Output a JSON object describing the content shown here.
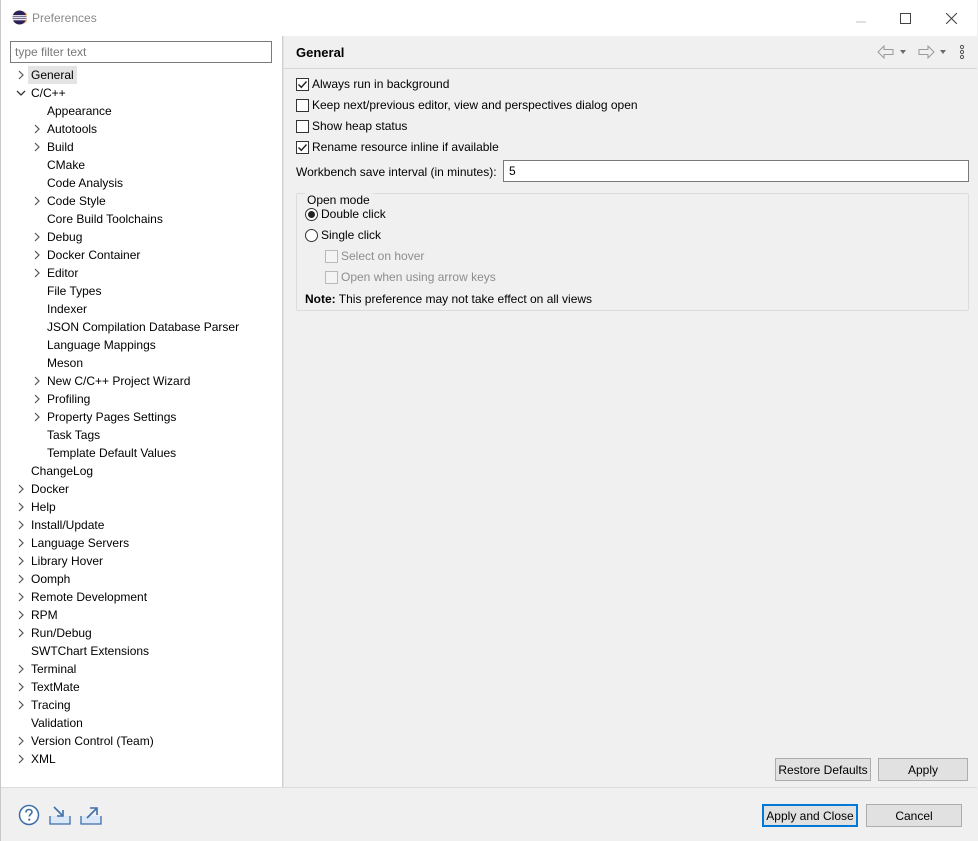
{
  "window": {
    "title": "Preferences"
  },
  "filter": {
    "placeholder": "type filter text"
  },
  "tree": {
    "general": "General",
    "cpp": "C/C++",
    "cpp_children": [
      "Appearance",
      "Autotools",
      "Build",
      "CMake",
      "Code Analysis",
      "Code Style",
      "Core Build Toolchains",
      "Debug",
      "Docker Container",
      "Editor",
      "File Types",
      "Indexer",
      "JSON Compilation Database Parser",
      "Language Mappings",
      "Meson",
      "New C/C++ Project Wizard",
      "Profiling",
      "Property Pages Settings",
      "Task Tags",
      "Template Default Values"
    ],
    "top_level": [
      "ChangeLog",
      "Docker",
      "Help",
      "Install/Update",
      "Language Servers",
      "Library Hover",
      "Oomph",
      "Remote Development",
      "RPM",
      "Run/Debug",
      "SWTChart Extensions",
      "Terminal",
      "TextMate",
      "Tracing",
      "Validation",
      "Version Control (Team)",
      "XML"
    ]
  },
  "page": {
    "title": "General",
    "always_run": "Always run in background",
    "keep_dialog": "Keep next/previous editor, view and perspectives dialog open",
    "heap_status": "Show heap status",
    "rename_inline": "Rename resource inline if available",
    "save_interval_label": "Workbench save interval (in minutes):",
    "save_interval_value": "5",
    "open_mode": {
      "legend": "Open mode",
      "double_click": "Double click",
      "single_click": "Single click",
      "select_on_hover": "Select on hover",
      "open_arrow_keys": "Open when using arrow keys",
      "note_label": "Note:",
      "note_text": "This preference may not take effect on all views"
    }
  },
  "buttons": {
    "restore_defaults": "Restore Defaults",
    "apply": "Apply",
    "apply_and_close": "Apply and Close",
    "cancel": "Cancel"
  },
  "icons": {
    "app": "eclipse-icon",
    "help": "help-icon",
    "import": "import-icon",
    "export": "export-icon",
    "back": "back-arrow-icon",
    "forward": "forward-arrow-icon",
    "menu": "view-menu-icon"
  }
}
